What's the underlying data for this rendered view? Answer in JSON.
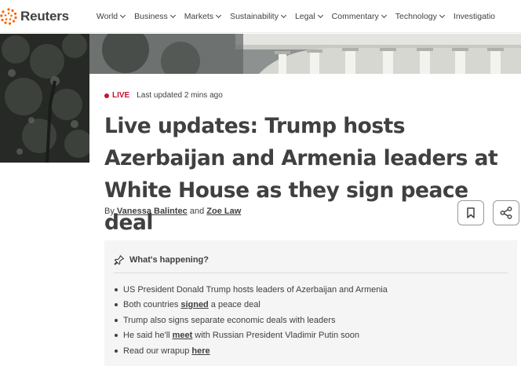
{
  "brand": {
    "name": "Reuters",
    "accent": "#fa6400"
  },
  "nav": {
    "items": [
      {
        "label": "World"
      },
      {
        "label": "Business"
      },
      {
        "label": "Markets"
      },
      {
        "label": "Sustainability"
      },
      {
        "label": "Legal"
      },
      {
        "label": "Commentary"
      },
      {
        "label": "Technology"
      },
      {
        "label": "Investigatio"
      }
    ]
  },
  "article": {
    "live_label": "LIVE",
    "live_color": "#c8102e",
    "updated": "Last updated 2 mins ago",
    "headline": "Live updates: Trump hosts Azerbaijan and Armenia leaders at White House as they sign peace deal",
    "byline_prefix": "By",
    "author1": "Vanessa Balintec",
    "byline_and": "and",
    "author2": "Zoe Law",
    "bookmark_icon": "bookmark-icon",
    "share_icon": "share-icon"
  },
  "happening": {
    "title": "What's happening?",
    "items": [
      {
        "pre": "US President Donald Trump hosts leaders of Azerbaijan and Armenia",
        "link": "",
        "post": ""
      },
      {
        "pre": "Both countries",
        "link": "signed",
        "post": "a peace deal"
      },
      {
        "pre": "Trump also signs separate economic deals with leaders",
        "link": "",
        "post": ""
      },
      {
        "pre": "He said he'll",
        "link": "meet",
        "post": "with Russian President Vladimir Putin soon"
      },
      {
        "pre": "Read our wrapup",
        "link": "here",
        "post": ""
      }
    ]
  }
}
